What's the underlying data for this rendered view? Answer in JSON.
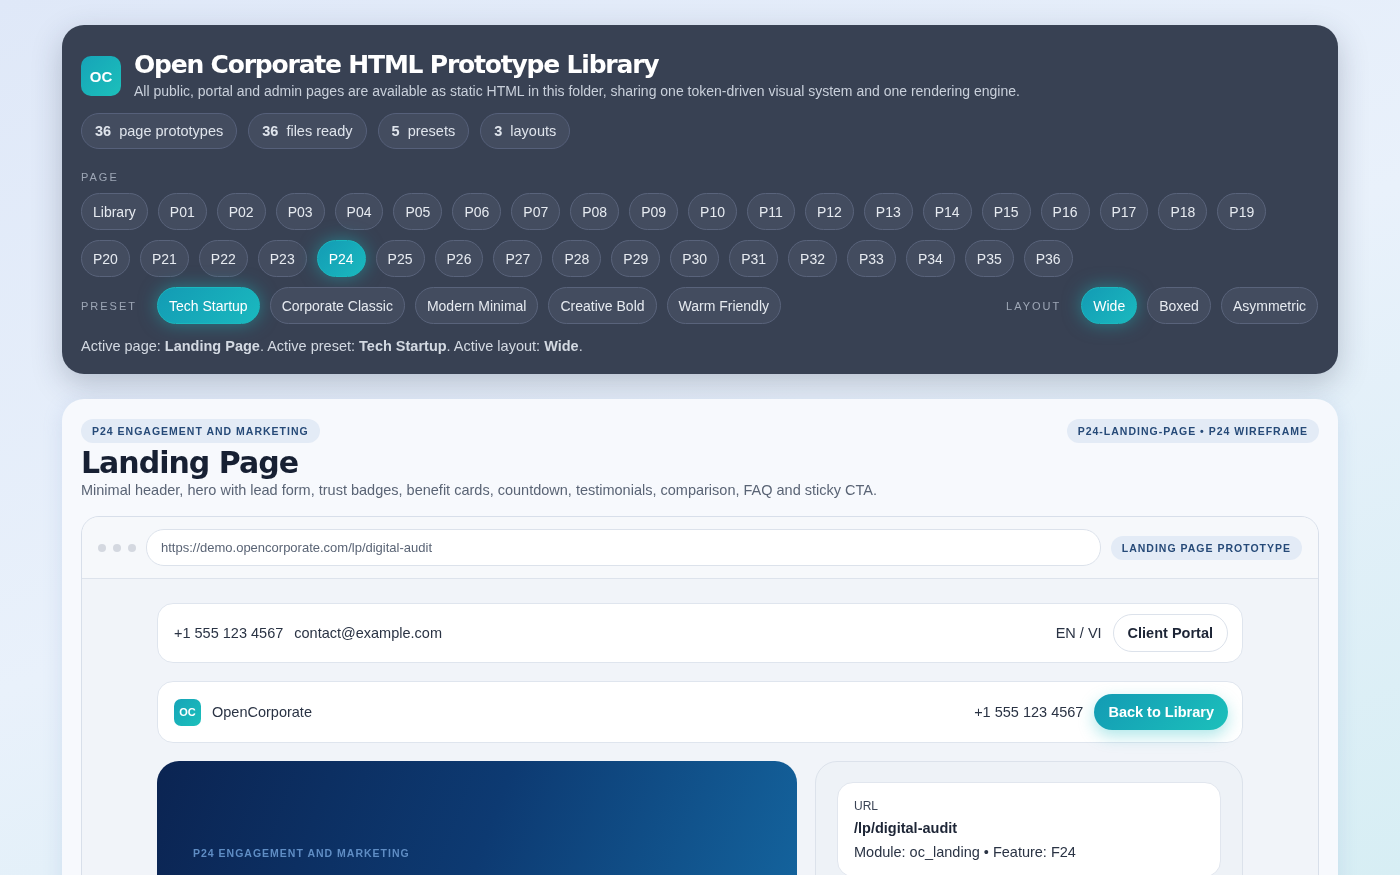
{
  "library": {
    "logo": "OC",
    "title": "Open Corporate HTML Prototype Library",
    "subtitle": "All public, portal and admin pages are available as static HTML in this folder, sharing one token-driven visual system and one rendering engine.",
    "stats": [
      {
        "value": "36",
        "label": "page prototypes"
      },
      {
        "value": "36",
        "label": "files ready"
      },
      {
        "value": "5",
        "label": "presets"
      },
      {
        "value": "3",
        "label": "layouts"
      }
    ],
    "page_label": "PAGE",
    "page_rows": [
      [
        {
          "label": "Library",
          "selected": false
        },
        {
          "label": "P01",
          "selected": false
        },
        {
          "label": "P02",
          "selected": false
        },
        {
          "label": "P03",
          "selected": false
        },
        {
          "label": "P04",
          "selected": false
        },
        {
          "label": "P05",
          "selected": false
        },
        {
          "label": "P06",
          "selected": false
        },
        {
          "label": "P07",
          "selected": false
        },
        {
          "label": "P08",
          "selected": false
        },
        {
          "label": "P09",
          "selected": false
        },
        {
          "label": "P10",
          "selected": false
        },
        {
          "label": "P11",
          "selected": false
        },
        {
          "label": "P12",
          "selected": false
        },
        {
          "label": "P13",
          "selected": false
        },
        {
          "label": "P14",
          "selected": false
        },
        {
          "label": "P15",
          "selected": false
        },
        {
          "label": "P16",
          "selected": false
        },
        {
          "label": "P17",
          "selected": false
        },
        {
          "label": "P18",
          "selected": false
        },
        {
          "label": "P19",
          "selected": false
        }
      ],
      [
        {
          "label": "P20",
          "selected": false
        },
        {
          "label": "P21",
          "selected": false
        },
        {
          "label": "P22",
          "selected": false
        },
        {
          "label": "P23",
          "selected": false
        },
        {
          "label": "P24",
          "selected": true
        },
        {
          "label": "P25",
          "selected": false
        },
        {
          "label": "P26",
          "selected": false
        },
        {
          "label": "P27",
          "selected": false
        },
        {
          "label": "P28",
          "selected": false
        },
        {
          "label": "P29",
          "selected": false
        },
        {
          "label": "P30",
          "selected": false
        },
        {
          "label": "P31",
          "selected": false
        },
        {
          "label": "P32",
          "selected": false
        },
        {
          "label": "P33",
          "selected": false
        },
        {
          "label": "P34",
          "selected": false
        },
        {
          "label": "P35",
          "selected": false
        },
        {
          "label": "P36",
          "selected": false
        }
      ]
    ],
    "preset_label": "PRESET",
    "presets": [
      {
        "label": "Tech Startup",
        "selected": true
      },
      {
        "label": "Corporate Classic",
        "selected": false
      },
      {
        "label": "Modern Minimal",
        "selected": false
      },
      {
        "label": "Creative Bold",
        "selected": false
      },
      {
        "label": "Warm Friendly",
        "selected": false
      }
    ],
    "layout_label": "LAYOUT",
    "layouts": [
      {
        "label": "Wide",
        "selected": true
      },
      {
        "label": "Boxed",
        "selected": false
      },
      {
        "label": "Asymmetric",
        "selected": false
      }
    ],
    "status": "Active page: **Landing Page**. Active preset: **Tech Startup**. Active layout: **Wide**."
  },
  "preview": {
    "category": "P24 ENGAGEMENT AND MARKETING",
    "tag": "P24-LANDING-PAGE • P24 WIREFRAME",
    "title": "Landing Page",
    "description": "Minimal header, hero with lead form, trust badges, benefit cards, countdown, testimonials, comparison, FAQ and sticky CTA.",
    "browser": {
      "url": "https://demo.opencorporate.com/lp/digital-audit",
      "badge": "LANDING PAGE PROTOTYPE"
    },
    "topbar": {
      "phone": "+1 555 123 4567",
      "email": "contact@example.com",
      "language": "EN / VI",
      "portal_button": "Client Portal"
    },
    "navbar": {
      "logo": "OC",
      "brand": "OpenCorporate",
      "phone": "+1 555 123 4567",
      "button": "Back to Library"
    },
    "hero": {
      "eyebrow": "P24 ENGAGEMENT AND MARKETING"
    },
    "info": {
      "label": "URL",
      "url": "/lp/digital-audit",
      "meta": "Module: oc_landing • Feature: F24"
    }
  }
}
